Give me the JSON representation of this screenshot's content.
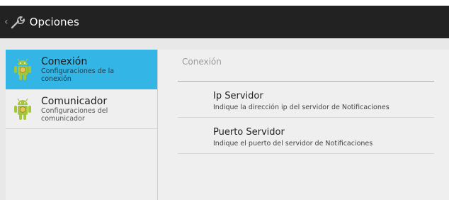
{
  "action_bar": {
    "title": "Opciones",
    "up_caret": "‹",
    "icon": "wrench-icon",
    "background": "#222222"
  },
  "headers": [
    {
      "title": "Conexión",
      "summary": "Configuraciones de la conexión",
      "icon": "android-robot-icon",
      "selected": true
    },
    {
      "title": "Comunicador",
      "summary": "Configuraciones del comunicador",
      "icon": "android-robot-icon",
      "selected": false
    }
  ],
  "detail": {
    "category": "Conexión",
    "items": [
      {
        "title": "Ip Servidor",
        "summary": "Indique la dirección ip del servidor de Notificaciones"
      },
      {
        "title": "Puerto Servidor",
        "summary": "Indique el puerto del servidor de Notificaciones"
      }
    ]
  },
  "colors": {
    "accent": "#33b5e5",
    "android_green": "#a4c639"
  }
}
